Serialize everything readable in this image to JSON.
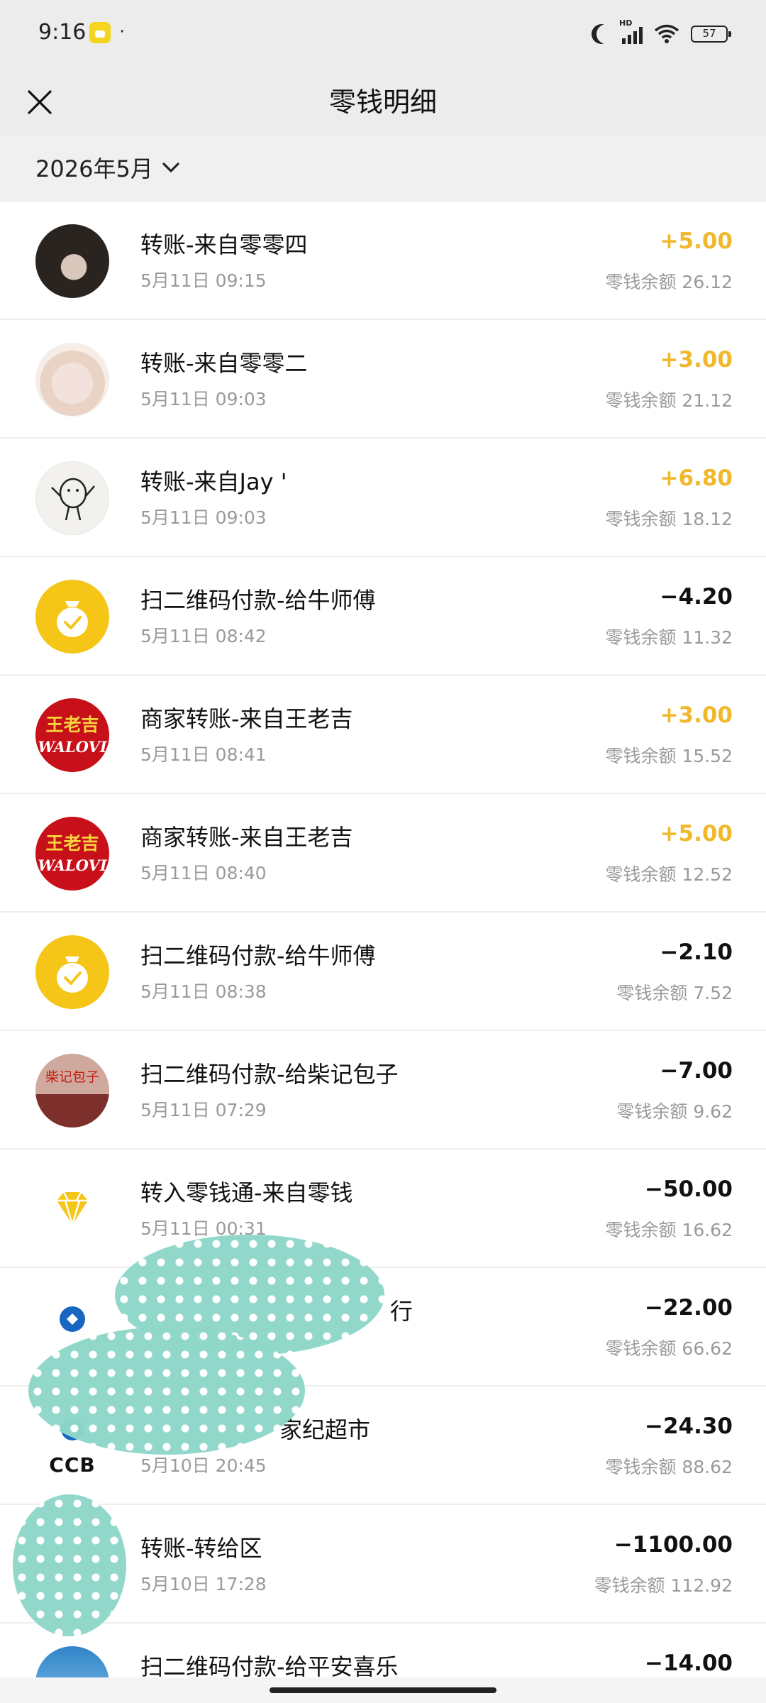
{
  "status_bar": {
    "time": "9:16",
    "dot": "·",
    "battery": "57",
    "signal_label": "HD"
  },
  "header": {
    "title": "零钱明细",
    "close_icon": "close-icon"
  },
  "filter": {
    "month": "2026年5月",
    "icon": "chevron-down-icon"
  },
  "colors": {
    "income": "#f0b82d",
    "expense": "#111111",
    "pay_icon_bg": "#f5c518",
    "brand_red": "#c8101a"
  },
  "transactions": [
    {
      "avatar": "portrait-photo",
      "title": "转账-来自零零四",
      "time": "5月11日 09:15",
      "amount": "+5.00",
      "type": "income",
      "balance": "零钱余额 26.12"
    },
    {
      "avatar": "anime-avatar",
      "title": "转账-来自零零二",
      "time": "5月11日 09:03",
      "amount": "+3.00",
      "type": "income",
      "balance": "零钱余额 21.12"
    },
    {
      "avatar": "doodle-avatar",
      "title": "转账-来自Jay '",
      "time": "5月11日 09:03",
      "amount": "+6.80",
      "type": "income",
      "balance": "零钱余额 18.12"
    },
    {
      "avatar": "money-bag-icon",
      "title": "扫二维码付款-给牛师傅",
      "time": "5月11日 08:42",
      "amount": "−4.20",
      "type": "expense",
      "balance": "零钱余额 11.32"
    },
    {
      "avatar": "wanglaoji-logo",
      "logo_cn": "王老吉",
      "logo_en": "WALOVI",
      "title": "商家转账-来自王老吉",
      "time": "5月11日 08:41",
      "amount": "+3.00",
      "type": "income",
      "balance": "零钱余额 15.52"
    },
    {
      "avatar": "wanglaoji-logo",
      "logo_cn": "王老吉",
      "logo_en": "WALOVI",
      "title": "商家转账-来自王老吉",
      "time": "5月11日 08:40",
      "amount": "+5.00",
      "type": "income",
      "balance": "零钱余额 12.52"
    },
    {
      "avatar": "money-bag-icon",
      "title": "扫二维码付款-给牛师傅",
      "time": "5月11日 08:38",
      "amount": "−2.10",
      "type": "expense",
      "balance": "零钱余额 7.52"
    },
    {
      "avatar": "shop-photo",
      "logo_cn": "柴记包子",
      "title": "扫二维码付款-给柴记包子",
      "time": "5月11日 07:29",
      "amount": "−7.00",
      "type": "expense",
      "balance": "零钱余额 9.62"
    },
    {
      "avatar": "diamond-icon",
      "title": "转入零钱通-来自零钱",
      "time": "5月11日 00:31",
      "amount": "−50.00",
      "type": "expense",
      "balance": "零钱余额 16.62"
    },
    {
      "avatar": "ccb-logo",
      "title": "行",
      "time": "",
      "amount": "−22.00",
      "type": "expense",
      "balance": "零钱余额 66.62"
    },
    {
      "avatar": "ccb-logo",
      "logo_text": "CCB",
      "title": "家纪超市",
      "time": "5月10日 20:45",
      "amount": "−24.30",
      "type": "expense",
      "balance": "零钱余额 88.62"
    },
    {
      "avatar": "hidden",
      "title": "转账-转给区",
      "time": "5月10日 17:28",
      "amount": "−1100.00",
      "type": "expense",
      "balance": "零钱余额 112.92"
    },
    {
      "avatar": "sky-photo",
      "title": "扫二维码付款-给平安喜乐",
      "time": "",
      "amount": "−14.00",
      "type": "expense",
      "balance": ""
    }
  ]
}
